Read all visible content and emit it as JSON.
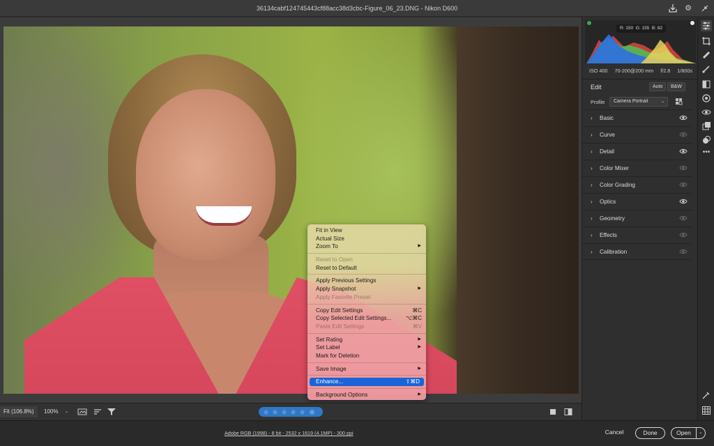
{
  "window": {
    "title": "36134cabf124745443cf88acc38d3cbc-Figure_06_23.DNG  -  Nikon D600"
  },
  "context_menu": {
    "items": [
      {
        "label": "Fit in View",
        "shortcut": "",
        "submenu": false,
        "disabled": false
      },
      {
        "label": "Actual Size",
        "shortcut": "",
        "submenu": false,
        "disabled": false
      },
      {
        "label": "Zoom To",
        "shortcut": "",
        "submenu": true,
        "disabled": false
      },
      {
        "label": "Reset to Open",
        "shortcut": "",
        "submenu": false,
        "disabled": true
      },
      {
        "label": "Reset to Default",
        "shortcut": "",
        "submenu": false,
        "disabled": false
      },
      {
        "label": "Apply Previous Settings",
        "shortcut": "",
        "submenu": false,
        "disabled": false
      },
      {
        "label": "Apply Snapshot",
        "shortcut": "",
        "submenu": true,
        "disabled": false
      },
      {
        "label": "Apply Favorite Preset",
        "shortcut": "",
        "submenu": false,
        "disabled": true
      },
      {
        "label": "Copy Edit Settings",
        "shortcut": "⌘C",
        "submenu": false,
        "disabled": false
      },
      {
        "label": "Copy Selected Edit Settings...",
        "shortcut": "⌥⌘C",
        "submenu": false,
        "disabled": false
      },
      {
        "label": "Paste Edit Settings",
        "shortcut": "⌘V",
        "submenu": false,
        "disabled": true
      },
      {
        "label": "Set Rating",
        "shortcut": "",
        "submenu": true,
        "disabled": false
      },
      {
        "label": "Set Label",
        "shortcut": "",
        "submenu": true,
        "disabled": false
      },
      {
        "label": "Mark for Deletion",
        "shortcut": "",
        "submenu": false,
        "disabled": false
      },
      {
        "label": "Save Image",
        "shortcut": "",
        "submenu": true,
        "disabled": false
      },
      {
        "label": "Enhance...",
        "shortcut": "⇧⌘D",
        "submenu": false,
        "disabled": false,
        "highlighted": true
      },
      {
        "label": "Background Options",
        "shortcut": "",
        "submenu": true,
        "disabled": false
      }
    ]
  },
  "histogram": {
    "r_label": "R: 150",
    "g_label": "G: 155",
    "b_label": "B: 82"
  },
  "camera_info": {
    "iso": "ISO 400",
    "lens": "70-200@200 mm",
    "aperture": "f/2.8",
    "shutter": "1/800s"
  },
  "edit": {
    "title": "Edit",
    "auto_label": "Auto",
    "bw_label": "B&W",
    "profile_label": "Profile",
    "profile_value": "Camera Portrait",
    "sections": [
      {
        "name": "Basic",
        "eye_active": true
      },
      {
        "name": "Curve",
        "eye_active": false
      },
      {
        "name": "Detail",
        "eye_active": true
      },
      {
        "name": "Color Mixer",
        "eye_active": false
      },
      {
        "name": "Color Grading",
        "eye_active": false
      },
      {
        "name": "Optics",
        "eye_active": true
      },
      {
        "name": "Geometry",
        "eye_active": false
      },
      {
        "name": "Effects",
        "eye_active": false
      },
      {
        "name": "Calibration",
        "eye_active": false
      }
    ]
  },
  "bottom": {
    "fit_label": "Fit (106.8%)",
    "zoom_label": "100%",
    "stars": [
      "☆",
      "☆",
      "☆",
      "☆",
      "☆"
    ]
  },
  "status": {
    "workflow_link": "Adobe RGB (1998) - 8 bit - 2532 x 1619 (4.1MP) - 300 ppi",
    "cancel_label": "Cancel",
    "done_label": "Done",
    "open_label": "Open"
  },
  "colors": {
    "accent_blue": "#1a64d8",
    "rating_bar": "#2f78c7"
  }
}
